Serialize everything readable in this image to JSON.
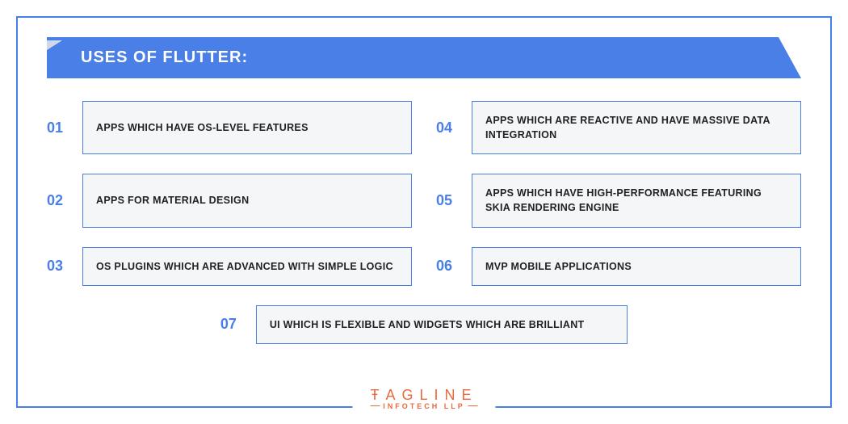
{
  "title": "USES OF FLUTTER:",
  "items": [
    {
      "num": "01",
      "text": "APPS WHICH HAVE OS-LEVEL FEATURES"
    },
    {
      "num": "02",
      "text": "APPS FOR MATERIAL DESIGN"
    },
    {
      "num": "03",
      "text": "OS PLUGINS WHICH ARE ADVANCED WITH SIMPLE LOGIC"
    },
    {
      "num": "04",
      "text": "APPS WHICH ARE REACTIVE AND HAVE MASSIVE DATA INTEGRATION"
    },
    {
      "num": "05",
      "text": "APPS WHICH HAVE HIGH-PERFORMANCE FEATURING SKIA RENDERING ENGINE"
    },
    {
      "num": "06",
      "text": "MVP MOBILE APPLICATIONS"
    },
    {
      "num": "07",
      "text": "UI WHICH IS FLEXIBLE AND WIDGETS WHICH ARE BRILLIANT"
    }
  ],
  "logo": {
    "top": "ŦAGLINE",
    "bottom": "INFOTECH LLP"
  },
  "colors": {
    "accent": "#4A7FE8",
    "brand": "#E86A3E"
  }
}
